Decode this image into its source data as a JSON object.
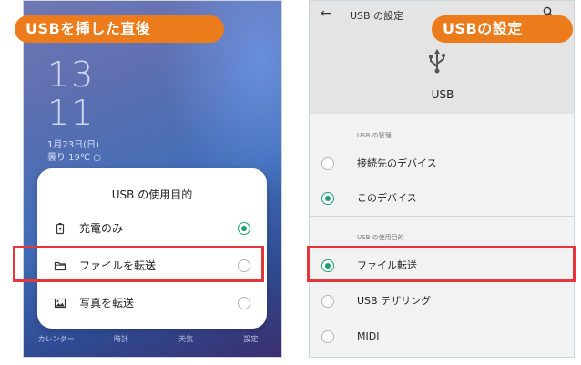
{
  "badges": {
    "left": "USBを挿した直後",
    "right": "USBの設定"
  },
  "left_phone": {
    "clock_hour": "13",
    "clock_minute": "11",
    "date": "1月23日(日)",
    "weather": "曇り 19℃ ○",
    "sheet": {
      "title": "USB の使用目的",
      "options": [
        {
          "label": "充電のみ",
          "icon": "battery-icon",
          "selected": true
        },
        {
          "label": "ファイルを転送",
          "icon": "folder-icon",
          "selected": false
        },
        {
          "label": "写真を転送",
          "icon": "photo-icon",
          "selected": false
        }
      ]
    },
    "dock": [
      "カレンダー",
      "時計",
      "天気",
      "設定"
    ]
  },
  "right_phone": {
    "back_icon": "back-arrow-icon",
    "title": "USB の設定",
    "usb_icon": "usb-icon",
    "usb_label": "USB",
    "section_manage": "USB の管理",
    "manage_options": [
      {
        "label": "接続先のデバイス",
        "selected": false
      },
      {
        "label": "このデバイス",
        "selected": true
      }
    ],
    "section_purpose": "USB の使用目的",
    "purpose_options": [
      {
        "label": "ファイル転送",
        "selected": true
      },
      {
        "label": "USB テザリング",
        "selected": false
      },
      {
        "label": "MIDI",
        "selected": false
      }
    ]
  },
  "colors": {
    "accent_orange": "#ec7c1b",
    "highlight_red": "#e5363b",
    "radio_green": "#1e9e74"
  }
}
